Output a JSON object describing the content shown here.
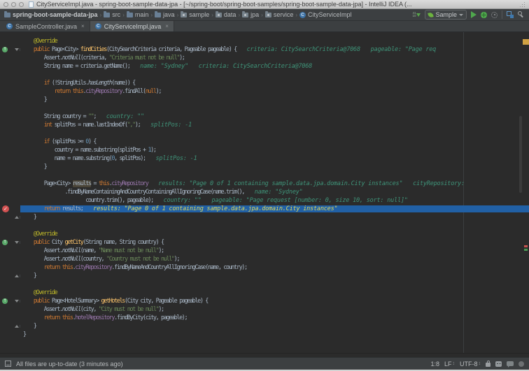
{
  "colors": {
    "editor_bg": "#2b2b2b",
    "chrome_bg": "#3c3f41",
    "exec_line_blue": "#2160a5",
    "breakpoint_red": "#d25252",
    "keyword_orange": "#cc7832",
    "string_green": "#6a8759",
    "annotation_yellow": "#bbb529",
    "method_yellow": "#ffc66d",
    "field_purple": "#9876aa",
    "hint_teal": "#3f9479",
    "hint_yellow": "#dcd65c",
    "stripe_orange": "#d1a243"
  },
  "title_bar": {
    "title": "CityServiceImpl.java - spring-boot-sample-data-jpa - [~/spring-boot/spring-boot-samples/spring-boot-sample-data-jpa] - IntelliJ IDEA (..."
  },
  "toolbar": {
    "breadcrumbs": [
      {
        "label": "spring-boot-sample-data-jpa",
        "icon": "folder"
      },
      {
        "label": "src",
        "icon": "folder"
      },
      {
        "label": "main",
        "icon": "folder"
      },
      {
        "label": "java",
        "icon": "folder"
      },
      {
        "label": "sample",
        "icon": "package"
      },
      {
        "label": "data",
        "icon": "package"
      },
      {
        "label": "jpa",
        "icon": "package"
      },
      {
        "label": "service",
        "icon": "package"
      },
      {
        "label": "CityServiceImpl",
        "icon": "class"
      }
    ],
    "class_icon_letter": "C",
    "jump_icon_digits": [
      "41",
      "10"
    ],
    "run_config": {
      "label": "Sample"
    }
  },
  "tabs": [
    {
      "label": "SampleController.java",
      "active": false
    },
    {
      "label": "CityServiceImpl.java",
      "active": true
    }
  ],
  "editor": {
    "breakpoint_check": "✓",
    "override_arrow": "↑",
    "lines": [
      {
        "s": [
          [
            "p",
            "    "
          ],
          [
            "a",
            "@Override"
          ]
        ]
      },
      {
        "g": "override",
        "f": "open",
        "s": [
          [
            "p",
            "    "
          ],
          [
            "k",
            "public"
          ],
          [
            "p",
            " Page<City> "
          ],
          [
            "m",
            "findCities"
          ],
          [
            "p",
            "(CitySearchCriteria criteria, Pageable pageable) {"
          ],
          [
            "h",
            "   criteria: CitySearchCriteria@7068   pageable: \"Page req"
          ]
        ]
      },
      {
        "s": [
          [
            "p",
            "        Assert."
          ],
          [
            "i",
            "notNull"
          ],
          [
            "p",
            "(criteria, "
          ],
          [
            "s",
            "\"Criteria must not be null\""
          ],
          [
            "p",
            ");"
          ]
        ]
      },
      {
        "s": [
          [
            "p",
            "        String name = criteria.getName();"
          ],
          [
            "h",
            "   name: \"Sydney\"   criteria: CitySearchCriteria@7068"
          ]
        ]
      },
      {
        "s": []
      },
      {
        "s": [
          [
            "p",
            "        "
          ],
          [
            "k",
            "if"
          ],
          [
            "p",
            " (!StringUtils."
          ],
          [
            "i",
            "hasLength"
          ],
          [
            "p",
            "(name)) {"
          ]
        ]
      },
      {
        "s": [
          [
            "p",
            "            "
          ],
          [
            "k",
            "return"
          ],
          [
            "p",
            " "
          ],
          [
            "k",
            "this"
          ],
          [
            "p",
            "."
          ],
          [
            "f",
            "cityRepository"
          ],
          [
            "p",
            ".findAll("
          ],
          [
            "k",
            "null"
          ],
          [
            "p",
            ");"
          ]
        ]
      },
      {
        "s": [
          [
            "p",
            "        }"
          ]
        ]
      },
      {
        "s": []
      },
      {
        "s": [
          [
            "p",
            "        String country = "
          ],
          [
            "s",
            "\"\""
          ],
          [
            "p",
            ";"
          ],
          [
            "h",
            "   country: \"\""
          ]
        ]
      },
      {
        "s": [
          [
            "p",
            "        "
          ],
          [
            "k",
            "int"
          ],
          [
            "p",
            " splitPos = name.lastIndexOf("
          ],
          [
            "s",
            "\",\""
          ],
          [
            "p",
            ");"
          ],
          [
            "h",
            "   splitPos: -1"
          ]
        ]
      },
      {
        "s": []
      },
      {
        "s": [
          [
            "p",
            "        "
          ],
          [
            "k",
            "if"
          ],
          [
            "p",
            " (splitPos >= "
          ],
          [
            "n",
            "0"
          ],
          [
            "p",
            ") {"
          ]
        ]
      },
      {
        "s": [
          [
            "p",
            "            country = name.substring(splitPos + "
          ],
          [
            "n",
            "1"
          ],
          [
            "p",
            ");"
          ]
        ]
      },
      {
        "s": [
          [
            "p",
            "            name = name.substring("
          ],
          [
            "n",
            "0"
          ],
          [
            "p",
            ", splitPos);"
          ],
          [
            "h",
            "   splitPos: -1"
          ]
        ]
      },
      {
        "s": [
          [
            "p",
            "        }"
          ]
        ]
      },
      {
        "s": []
      },
      {
        "s": [
          [
            "p",
            "        Page<City> "
          ],
          [
            "w",
            "results"
          ],
          [
            "p",
            " = "
          ],
          [
            "k",
            "this"
          ],
          [
            "p",
            "."
          ],
          [
            "f",
            "cityRepository"
          ],
          [
            "h",
            "   results: \"Page 0 of 1 containing sample.data.jpa.domain.City instances\"   cityRepository:"
          ]
        ]
      },
      {
        "s": [
          [
            "p",
            "                .findByNameContainingAndCountryContainingAllIgnoringCase(name.trim(),"
          ],
          [
            "h",
            "   name: \"Sydney\""
          ]
        ]
      },
      {
        "s": [
          [
            "p",
            "                        country.trim(), pageable);"
          ],
          [
            "h",
            "   country: \"\"   pageable: \"Page request [number: 0, size 10, sort: null]\""
          ]
        ]
      },
      {
        "g": "breakpoint",
        "x": true,
        "s": [
          [
            "p",
            "        "
          ],
          [
            "k",
            "return"
          ],
          [
            "p",
            " results;"
          ],
          [
            "y",
            "   results: \"Page 0 of 1 containing sample.data.jpa.domain.City instances\""
          ]
        ]
      },
      {
        "f": "end",
        "s": [
          [
            "p",
            "    }"
          ]
        ]
      },
      {
        "s": []
      },
      {
        "s": [
          [
            "p",
            "    "
          ],
          [
            "a",
            "@Override"
          ]
        ]
      },
      {
        "g": "override",
        "f": "open",
        "s": [
          [
            "p",
            "    "
          ],
          [
            "k",
            "public"
          ],
          [
            "p",
            " City "
          ],
          [
            "m",
            "getCity"
          ],
          [
            "p",
            "(String name, String country) {"
          ]
        ]
      },
      {
        "s": [
          [
            "p",
            "        Assert."
          ],
          [
            "i",
            "notNull"
          ],
          [
            "p",
            "(name, "
          ],
          [
            "s",
            "\"Name must not be null\""
          ],
          [
            "p",
            ");"
          ]
        ]
      },
      {
        "s": [
          [
            "p",
            "        Assert."
          ],
          [
            "i",
            "notNull"
          ],
          [
            "p",
            "(country, "
          ],
          [
            "s",
            "\"Country must not be null\""
          ],
          [
            "p",
            ");"
          ]
        ]
      },
      {
        "s": [
          [
            "p",
            "        "
          ],
          [
            "k",
            "return"
          ],
          [
            "p",
            " "
          ],
          [
            "k",
            "this"
          ],
          [
            "p",
            "."
          ],
          [
            "f",
            "cityRepository"
          ],
          [
            "p",
            ".findByNameAndCountryAllIgnoringCase(name, country);"
          ]
        ]
      },
      {
        "f": "end",
        "s": [
          [
            "p",
            "    }"
          ]
        ]
      },
      {
        "s": []
      },
      {
        "s": [
          [
            "p",
            "    "
          ],
          [
            "a",
            "@Override"
          ]
        ]
      },
      {
        "g": "override",
        "f": "open",
        "s": [
          [
            "p",
            "    "
          ],
          [
            "k",
            "public"
          ],
          [
            "p",
            " Page<HotelSummary> "
          ],
          [
            "m",
            "getHotels"
          ],
          [
            "p",
            "(City city, Pageable pageable) {"
          ]
        ]
      },
      {
        "s": [
          [
            "p",
            "        Assert."
          ],
          [
            "i",
            "notNull"
          ],
          [
            "p",
            "(city, "
          ],
          [
            "s",
            "\"City must not be null\""
          ],
          [
            "p",
            ");"
          ]
        ]
      },
      {
        "s": [
          [
            "p",
            "        "
          ],
          [
            "k",
            "return"
          ],
          [
            "p",
            " "
          ],
          [
            "k",
            "this"
          ],
          [
            "p",
            "."
          ],
          [
            "f",
            "hotelRepository"
          ],
          [
            "p",
            ".findByCity(city, pageable);"
          ]
        ]
      },
      {
        "f": "end",
        "s": [
          [
            "p",
            "    }"
          ]
        ]
      },
      {
        "s": [
          [
            "p",
            "}"
          ]
        ]
      }
    ]
  },
  "status_bar": {
    "left_text": "All files are up-to-date (3 minutes ago)",
    "caret": "1:8",
    "line_ending": "LF",
    "encoding": "UTF-8"
  }
}
